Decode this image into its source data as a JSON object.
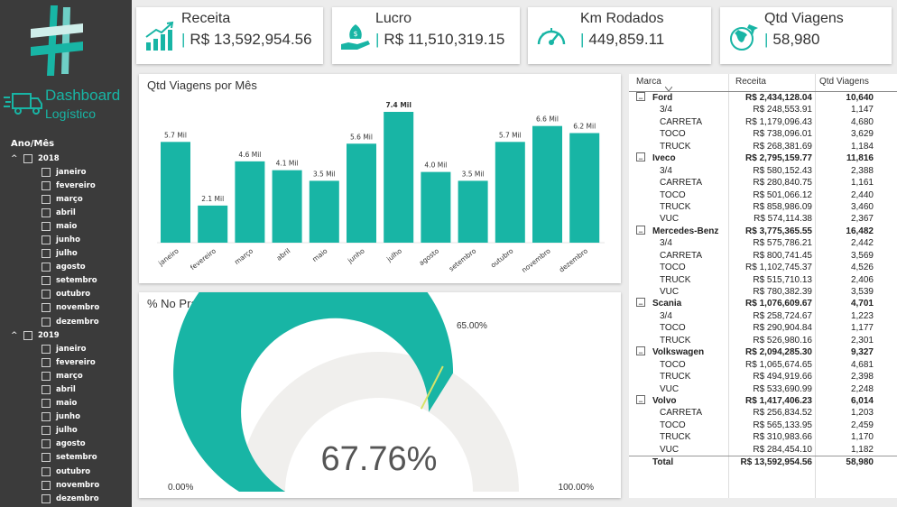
{
  "sidebar": {
    "title": "Dashboard",
    "subtitle": "Logístico",
    "filter_title": "Ano/Mês",
    "years": [
      {
        "year": "2018",
        "months": [
          "janeiro",
          "fevereiro",
          "março",
          "abril",
          "maio",
          "junho",
          "julho",
          "agosto",
          "setembro",
          "outubro",
          "novembro",
          "dezembro"
        ]
      },
      {
        "year": "2019",
        "months": [
          "janeiro",
          "fevereiro",
          "março",
          "abril",
          "maio",
          "junho",
          "julho",
          "agosto",
          "setembro",
          "outubro",
          "novembro",
          "dezembro"
        ]
      }
    ]
  },
  "kpis": [
    {
      "title": "Receita",
      "value": "R$ 13,592,954.56",
      "icon": "growth-chart-icon"
    },
    {
      "title": "Lucro",
      "value": "R$ 11,510,319.15",
      "icon": "money-hand-icon"
    },
    {
      "title": "Km Rodados",
      "value": "449,859.11",
      "icon": "speedometer-icon"
    },
    {
      "title": "Qtd Viagens",
      "value": "58,980",
      "icon": "globe-plane-icon"
    }
  ],
  "bar_panel": {
    "title": "Qtd Viagens por Mês"
  },
  "gauge_panel": {
    "title": "% No Prazo"
  },
  "colors": {
    "accent": "#18b5a5",
    "track": "#f0efed",
    "target": "#d6e36a"
  },
  "chart_data": [
    {
      "type": "bar",
      "title": "Qtd Viagens por Mês",
      "categories": [
        "janeiro",
        "fevereiro",
        "março",
        "abril",
        "maio",
        "junho",
        "julho",
        "agosto",
        "setembro",
        "outubro",
        "novembro",
        "dezembro"
      ],
      "values": [
        5.7,
        2.1,
        4.6,
        4.1,
        3.5,
        5.6,
        7.4,
        4.0,
        3.5,
        5.7,
        6.6,
        6.2
      ],
      "labels": [
        "5.7 Mil",
        "2.1 Mil",
        "4.6 Mil",
        "4.1 Mil",
        "3.5 Mil",
        "5.6 Mil",
        "7.4 Mil",
        "4.0 Mil",
        "3.5 Mil",
        "5.7 Mil",
        "6.6 Mil",
        "6.2 Mil"
      ],
      "ylim": [
        0,
        7.4
      ]
    },
    {
      "type": "gauge",
      "title": "% No Prazo",
      "value": 67.76,
      "value_label": "67.76%",
      "target": 65.0,
      "target_label": "65.00%",
      "min": 0,
      "max": 100,
      "min_label": "0.00%",
      "max_label": "100.00%"
    }
  ],
  "table": {
    "headers": [
      "Marca",
      "Receita",
      "Qtd Viagens"
    ],
    "groups": [
      {
        "brand": "Ford",
        "receita": "R$ 2,434,128.04",
        "qtd": "10,640",
        "rows": [
          [
            "3/4",
            "R$ 248,553.91",
            "1,147"
          ],
          [
            "CARRETA",
            "R$ 1,179,096.43",
            "4,680"
          ],
          [
            "TOCO",
            "R$ 738,096.01",
            "3,629"
          ],
          [
            "TRUCK",
            "R$ 268,381.69",
            "1,184"
          ]
        ]
      },
      {
        "brand": "Iveco",
        "receita": "R$ 2,795,159.77",
        "qtd": "11,816",
        "rows": [
          [
            "3/4",
            "R$ 580,152.43",
            "2,388"
          ],
          [
            "CARRETA",
            "R$ 280,840.75",
            "1,161"
          ],
          [
            "TOCO",
            "R$ 501,066.12",
            "2,440"
          ],
          [
            "TRUCK",
            "R$ 858,986.09",
            "3,460"
          ],
          [
            "VUC",
            "R$ 574,114.38",
            "2,367"
          ]
        ]
      },
      {
        "brand": "Mercedes-Benz",
        "receita": "R$ 3,775,365.55",
        "qtd": "16,482",
        "rows": [
          [
            "3/4",
            "R$ 575,786.21",
            "2,442"
          ],
          [
            "CARRETA",
            "R$ 800,741.45",
            "3,569"
          ],
          [
            "TOCO",
            "R$ 1,102,745.37",
            "4,526"
          ],
          [
            "TRUCK",
            "R$ 515,710.13",
            "2,406"
          ],
          [
            "VUC",
            "R$ 780,382.39",
            "3,539"
          ]
        ]
      },
      {
        "brand": "Scania",
        "receita": "R$ 1,076,609.67",
        "qtd": "4,701",
        "rows": [
          [
            "3/4",
            "R$ 258,724.67",
            "1,223"
          ],
          [
            "TOCO",
            "R$ 290,904.84",
            "1,177"
          ],
          [
            "TRUCK",
            "R$ 526,980.16",
            "2,301"
          ]
        ]
      },
      {
        "brand": "Volkswagen",
        "receita": "R$ 2,094,285.30",
        "qtd": "9,327",
        "rows": [
          [
            "TOCO",
            "R$ 1,065,674.65",
            "4,681"
          ],
          [
            "TRUCK",
            "R$ 494,919.66",
            "2,398"
          ],
          [
            "VUC",
            "R$ 533,690.99",
            "2,248"
          ]
        ]
      },
      {
        "brand": "Volvo",
        "receita": "R$ 1,417,406.23",
        "qtd": "6,014",
        "rows": [
          [
            "CARRETA",
            "R$ 256,834.52",
            "1,203"
          ],
          [
            "TOCO",
            "R$ 565,133.95",
            "2,459"
          ],
          [
            "TRUCK",
            "R$ 310,983.66",
            "1,170"
          ],
          [
            "VUC",
            "R$ 284,454.10",
            "1,182"
          ]
        ]
      }
    ],
    "total": {
      "label": "Total",
      "receita": "R$ 13,592,954.56",
      "qtd": "58,980"
    }
  }
}
